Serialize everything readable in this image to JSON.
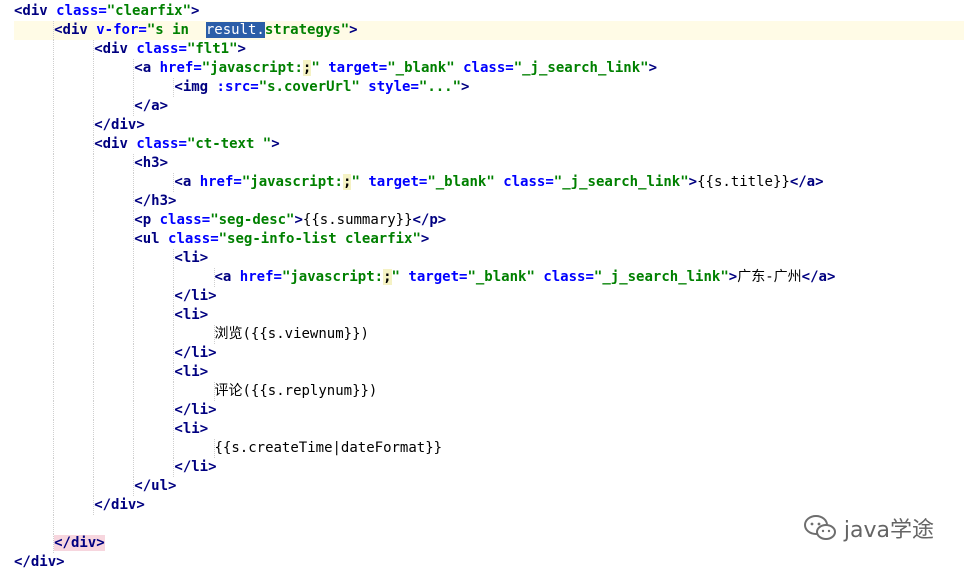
{
  "code_lines": [
    "<div class=\"clearfix\">",
    "<div v-for=\"s in  result.strategys\">",
    "<div class=\"flt1\">",
    "<a href=\"javascript:;\" target=\"_blank\" class=\"_j_search_link\">",
    "<img :src=\"s.coverUrl\" style=\"...\">",
    "</a>",
    "</div>",
    "<div class=\"ct-text \">",
    "<h3>",
    "<a href=\"javascript:;\" target=\"_blank\" class=\"_j_search_link\">{{s.title}}</a>",
    "</h3>",
    "<p class=\"seg-desc\">{{s.summary}}</p>",
    "<ul class=\"seg-info-list clearfix\">",
    "<li>",
    "<a href=\"javascript:;\" target=\"_blank\" class=\"_j_search_link\">广东-广州</a>",
    "</li>",
    "<li>",
    "浏览({{s.viewnum}})",
    "</li>",
    "<li>",
    "评论({{s.replynum}})",
    "</li>",
    "<li>",
    "{{s.createTime|dateFormat}}",
    "</li>",
    "</ul>",
    "</div>",
    "",
    "</div>",
    "</div>"
  ],
  "watermark": {
    "text": "java学途",
    "icon": "wechat-icon"
  },
  "colors": {
    "tag": "#000080",
    "attr_name": "#0000ff",
    "attr_value": "#008000",
    "selection": "#2b5ea8",
    "current_line": "#fffbe6",
    "tag_highlight": "#f7d6de"
  }
}
